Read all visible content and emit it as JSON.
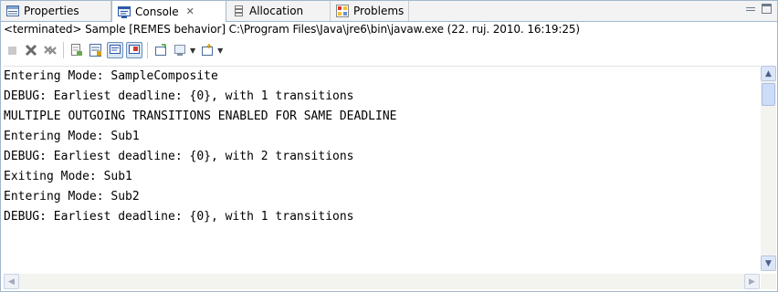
{
  "tabs": [
    {
      "label": "Properties",
      "icon": "properties-icon"
    },
    {
      "label": "Console",
      "icon": "console-icon",
      "close": "✕"
    },
    {
      "label": "Allocation",
      "icon": "allocation-icon"
    },
    {
      "label": "Problems",
      "icon": "problems-icon"
    }
  ],
  "process_info": "<terminated> Sample [REMES behavior] C:\\Program Files\\Java\\jre6\\bin\\javaw.exe (22. ruj. 2010. 16:19:25)",
  "toolbar": [
    "terminate-icon",
    "remove-launch-icon",
    "remove-all-terminated-icon",
    "clear-console-icon",
    "scroll-lock-icon",
    "show-on-stdout-icon",
    "show-on-stderr-icon",
    "pin-console-icon",
    "display-selected-console-icon",
    "open-console-icon"
  ],
  "console_lines": [
    "Entering Mode: SampleComposite",
    "DEBUG: Earliest deadline: {0}, with 1 transitions",
    "MULTIPLE OUTGOING TRANSITIONS ENABLED FOR SAME DEADLINE",
    "Entering Mode: Sub1",
    "DEBUG: Earliest deadline: {0}, with 2 transitions",
    "Exiting Mode: Sub1",
    "Entering Mode: Sub2",
    "DEBUG: Earliest deadline: {0}, with 1 transitions"
  ],
  "colors": {
    "border": "#a3b8cc",
    "tab_bg": "#f3f3f3",
    "scroll_accent": "#dbe6f8"
  }
}
